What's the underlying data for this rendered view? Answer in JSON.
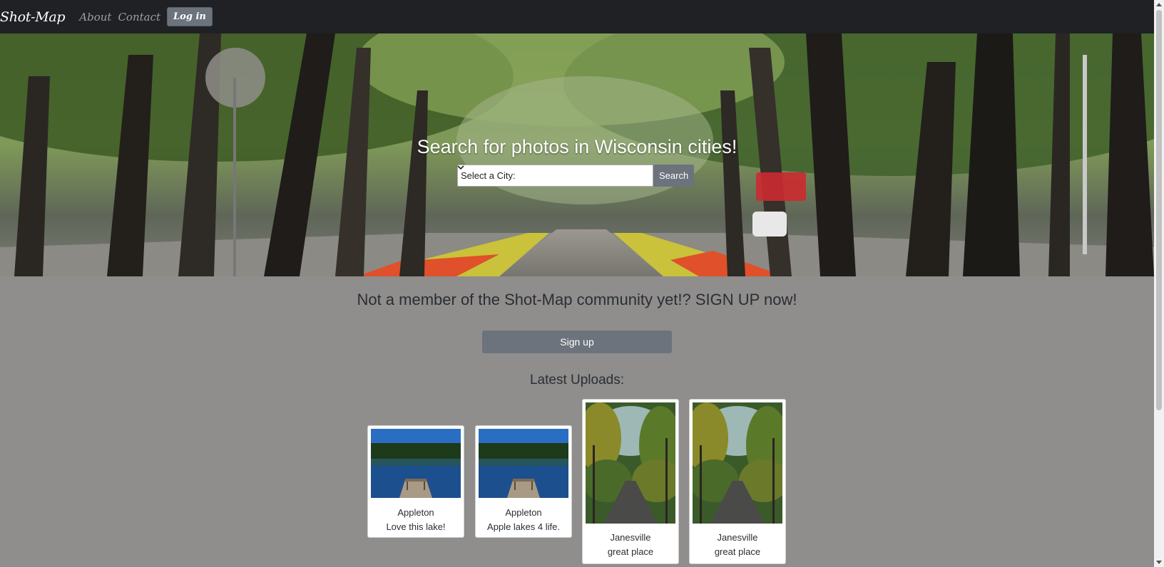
{
  "navbar": {
    "brand": "Shot-Map",
    "links": [
      {
        "label": "About"
      },
      {
        "label": "Contact"
      }
    ],
    "login_label": "Log in"
  },
  "hero": {
    "title": "Search for photos in Wisconsin cities!",
    "select_value": "Select a City:",
    "search_label": "Search"
  },
  "signup": {
    "text": "Not a member of the Shot-Map community yet!? SIGN UP now!",
    "button_label": "Sign up"
  },
  "latest": {
    "title": "Latest Uploads:",
    "cards": [
      {
        "city": "Appleton",
        "caption": "Love this lake!",
        "photo": "lake-dock"
      },
      {
        "city": "Appleton",
        "caption": "Apple lakes 4 life.",
        "photo": "lake-dock"
      },
      {
        "city": "Janesville",
        "caption": "great place",
        "photo": "forest-road"
      },
      {
        "city": "Janesville",
        "caption": "great place",
        "photo": "forest-road"
      }
    ]
  },
  "colors": {
    "navbar_bg": "#1f2125",
    "page_bg": "#8f8e8c",
    "button_bg": "#6c737c"
  }
}
